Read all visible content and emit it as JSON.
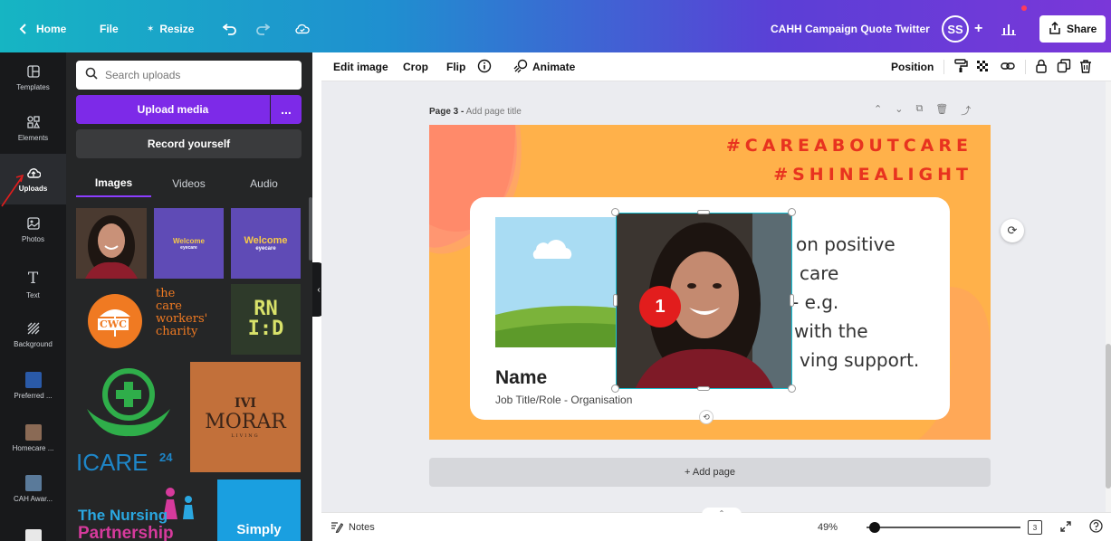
{
  "topbar": {
    "home_label": "Home",
    "file_label": "File",
    "resize_label": "Resize",
    "design_title": "CAHH Campaign Quote Twitter",
    "avatar_initials": "SS",
    "share_label": "Share"
  },
  "rail": {
    "items": [
      {
        "label": "Templates",
        "icon": "templates-icon"
      },
      {
        "label": "Elements",
        "icon": "elements-icon"
      },
      {
        "label": "Uploads",
        "icon": "uploads-icon",
        "active": true
      },
      {
        "label": "Photos",
        "icon": "photos-icon"
      },
      {
        "label": "Text",
        "icon": "text-icon"
      },
      {
        "label": "Background",
        "icon": "background-icon"
      },
      {
        "label": "Preferred ...",
        "icon": "folder-thumb"
      },
      {
        "label": "Homecare ...",
        "icon": "folder-thumb"
      },
      {
        "label": "CAH Awar...",
        "icon": "folder-thumb"
      },
      {
        "label": "",
        "icon": "folder-thumb"
      }
    ]
  },
  "uploads": {
    "search_placeholder": "Search uploads",
    "upload_media_label": "Upload media",
    "more_label": "...",
    "record_label": "Record yourself",
    "tabs": [
      {
        "label": "Images",
        "active": true
      },
      {
        "label": "Videos"
      },
      {
        "label": "Audio"
      }
    ],
    "thumbs": {
      "welcome_1_title": "Welcome",
      "welcome_1_sub": "eyecare",
      "welcome_2_title": "Welcome",
      "welcome_2_sub": "eyecare",
      "cwc_logo_text": "CWC",
      "cwc_line1": "the",
      "cwc_line2": "care",
      "cwc_line3": "workers'",
      "cwc_line4": "charity",
      "rnid_line1": "RN",
      "rnid_line2": "I:D",
      "icare_text": "ICARE",
      "icare_num": "24",
      "morar_mark": "IVI",
      "morar_text": "MORAR",
      "morar_sub": "LIVING",
      "nursing_line1": "The Nursing",
      "nursing_line2": "Partnership",
      "simply_text": "Simply"
    }
  },
  "toolbar": {
    "edit_image": "Edit image",
    "crop": "Crop",
    "flip": "Flip",
    "animate": "Animate",
    "position": "Position"
  },
  "canvas": {
    "page_label": "Page 3 -",
    "page_title_placeholder": "Add page title",
    "hashtag_1": "#CAREABOUTCARE",
    "hashtag_2": "#SHINEALIGHT",
    "quote_lines": [
      "on positive",
      "care",
      "- e.g.",
      "with the",
      "ving support."
    ],
    "name": "Name",
    "role": "Job Title/Role - Organisation",
    "step_badge": "1",
    "add_page_label": "+ Add page"
  },
  "bottombar": {
    "notes_label": "Notes",
    "zoom_level": "49%",
    "zoom_fraction": 0.05,
    "page_count": "3"
  },
  "colors": {
    "accent_purple": "#7d2ae8",
    "design_bg": "#ffb14a",
    "hashtag_red": "#e8331f",
    "selection_teal": "#19c3d6",
    "badge_red": "#e21d1d"
  }
}
